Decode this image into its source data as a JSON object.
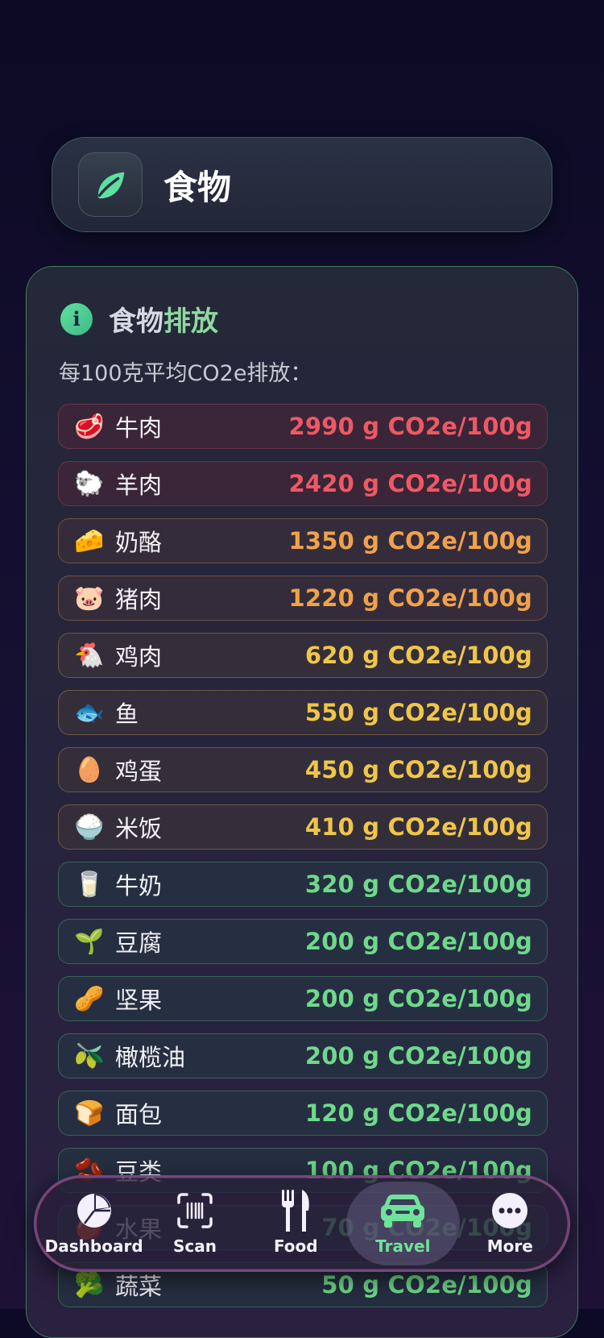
{
  "header": {
    "title": "食物",
    "icon": "leaf-icon"
  },
  "section": {
    "title_part1": "食物",
    "title_part2": "排放",
    "info_icon_glyph": "i",
    "subtitle": "每100克平均CO2e排放："
  },
  "foods": [
    {
      "emoji": "🥩",
      "name": "牛肉",
      "value": "2990 g CO2e/100g",
      "level": "red"
    },
    {
      "emoji": "🐑",
      "name": "羊肉",
      "value": "2420 g CO2e/100g",
      "level": "red"
    },
    {
      "emoji": "🧀",
      "name": "奶酪",
      "value": "1350 g CO2e/100g",
      "level": "orange"
    },
    {
      "emoji": "🐷",
      "name": "猪肉",
      "value": "1220 g CO2e/100g",
      "level": "orange"
    },
    {
      "emoji": "🐔",
      "name": "鸡肉",
      "value": "620 g CO2e/100g",
      "level": "yellow"
    },
    {
      "emoji": "🐟",
      "name": "鱼",
      "value": "550 g CO2e/100g",
      "level": "yellow"
    },
    {
      "emoji": "🥚",
      "name": "鸡蛋",
      "value": "450 g CO2e/100g",
      "level": "yellow"
    },
    {
      "emoji": "🍚",
      "name": "米饭",
      "value": "410 g CO2e/100g",
      "level": "yellow"
    },
    {
      "emoji": "🥛",
      "name": "牛奶",
      "value": "320 g CO2e/100g",
      "level": "green"
    },
    {
      "emoji": "🌱",
      "name": "豆腐",
      "value": "200 g CO2e/100g",
      "level": "green"
    },
    {
      "emoji": "🥜",
      "name": "坚果",
      "value": "200 g CO2e/100g",
      "level": "green"
    },
    {
      "emoji": "🫒",
      "name": "橄榄油",
      "value": "200 g CO2e/100g",
      "level": "green"
    },
    {
      "emoji": "🍞",
      "name": "面包",
      "value": "120 g CO2e/100g",
      "level": "green"
    },
    {
      "emoji": "🫘",
      "name": "豆类",
      "value": "100 g CO2e/100g",
      "level": "green"
    },
    {
      "emoji": "🍎",
      "name": "水果",
      "value": "70 g CO2e/100g",
      "level": "green"
    },
    {
      "emoji": "🥦",
      "name": "蔬菜",
      "value": "50 g CO2e/100g",
      "level": "green"
    }
  ],
  "tabbar": {
    "tabs": [
      {
        "label": "Dashboard",
        "icon": "pie-chart-icon",
        "active": false
      },
      {
        "label": "Scan",
        "icon": "barcode-scan-icon",
        "active": false
      },
      {
        "label": "Food",
        "icon": "fork-knife-icon",
        "active": false
      },
      {
        "label": "Travel",
        "icon": "car-icon",
        "active": true
      },
      {
        "label": "More",
        "icon": "more-dots-icon",
        "active": false
      }
    ]
  },
  "colors": {
    "red": "#ef5864",
    "orange": "#f0a24a",
    "yellow": "#f0c648",
    "green": "#6ed98a",
    "active_tab": "#6fe39a",
    "leaf": "#5fe0a0"
  }
}
